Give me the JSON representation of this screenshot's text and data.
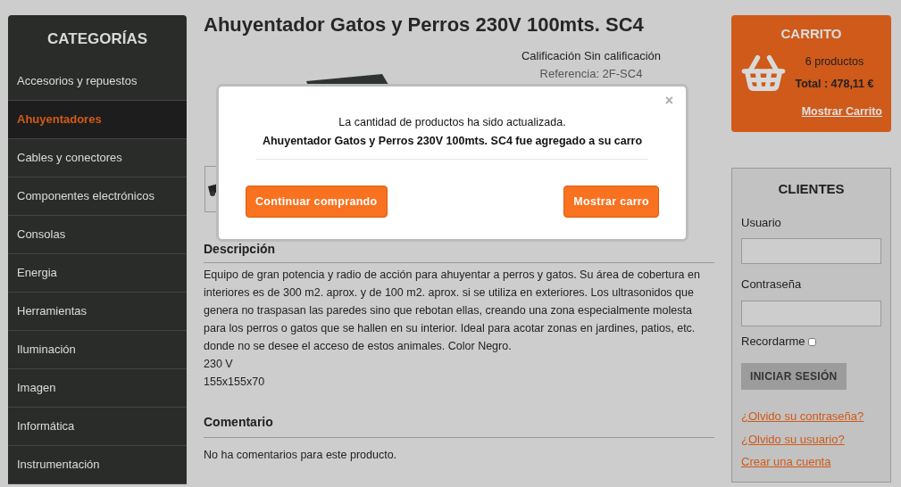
{
  "sidebar": {
    "title": "CATEGORÍAS",
    "items": [
      {
        "label": "Accesorios y repuestos",
        "selected": false
      },
      {
        "label": "Ahuyentadores",
        "selected": true
      },
      {
        "label": "Cables y conectores",
        "selected": false
      },
      {
        "label": "Componentes electrónicos",
        "selected": false
      },
      {
        "label": "Consolas",
        "selected": false
      },
      {
        "label": "Energia",
        "selected": false
      },
      {
        "label": "Herramientas",
        "selected": false
      },
      {
        "label": "Iluminación",
        "selected": false
      },
      {
        "label": "Imagen",
        "selected": false
      },
      {
        "label": "Informática",
        "selected": false
      },
      {
        "label": "Instrumentación",
        "selected": false
      }
    ]
  },
  "product": {
    "title": "Ahuyentador Gatos y Perros 230V 100mts. SC4",
    "rating": "Calificación Sin calificación",
    "reference": "Referencia: 2F-SC4",
    "description": {
      "heading": "Descripción",
      "paragraph": "Equipo de gran potencia y radio de acción para ahuyentar a perros y gatos. Su área de cobertura en interiores es de 300 m2. aprox. y de 100 m2. aprox. si se utiliza en exteriores. Los ultrasonidos que genera no traspasan las paredes sino que rebotan ellas, creando una zona especialmente molesta para los perros o gatos que se hallen en su interior. Ideal para acotar zonas en jardines, patios, etc. donde no se desee el acceso de estos animales. Color Negro.",
      "lines": [
        "230 V",
        "155x155x70"
      ]
    },
    "comments": {
      "heading": "Comentario",
      "text": "No ha comentarios para este producto."
    }
  },
  "modal": {
    "close": "×",
    "message": "La cantidad de productos ha sido actualizada.",
    "product_message": "Ahuyentador Gatos y Perros 230V 100mts. SC4 fue agregado a su carro",
    "buttons": [
      "Continuar comprando",
      "Mostrar carro"
    ]
  },
  "cart": {
    "title": "CARRITO",
    "count": "6 productos",
    "total": "Total : 478,11 €",
    "link": "Mostrar Carrito"
  },
  "login": {
    "title": "CLIENTES",
    "fields": [
      {
        "label": "Usuario"
      },
      {
        "label": "Contraseña"
      }
    ],
    "remember": {
      "label": "Recordarme",
      "checked": false
    },
    "button": "INICIAR SESIÓN",
    "links": [
      "¿Olvido su contraseña?",
      "¿Olvido su usuario?",
      "Crear una cuenta"
    ]
  }
}
